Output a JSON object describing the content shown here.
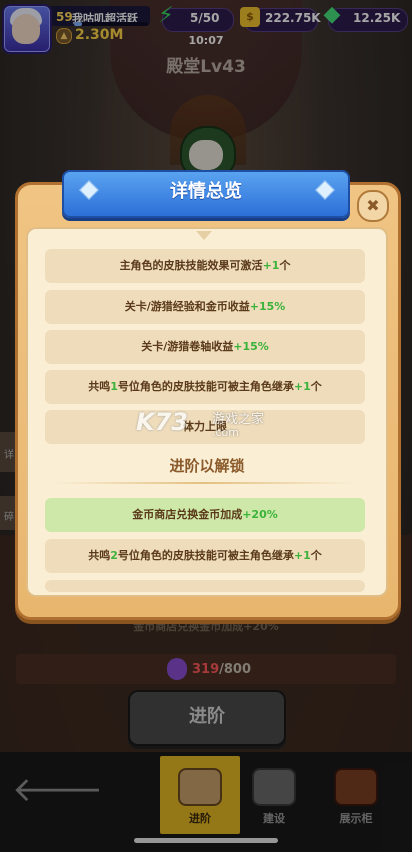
{
  "hud": {
    "level": "59",
    "player_name": "我咕叽超活跃",
    "power": "2.30M",
    "energy": "5/50",
    "gold": "222.75K",
    "gems": "12.25K",
    "time": "10:07"
  },
  "background": {
    "hall_title": "殿堂Lv43",
    "side_tab_1": "详",
    "side_tab_2": "碎",
    "dim_row_text": "金币商店兑换金币加成+20%",
    "progress_current": "319",
    "progress_slash": "/",
    "progress_total": "800",
    "advance_button": "进阶"
  },
  "modal": {
    "title": "详情总览",
    "close_symbol": "✖",
    "section_title": "进阶以解锁",
    "rows": [
      {
        "text": "主角色的皮肤技能效果可激活",
        "bonus": "+1",
        "suffix": "个"
      },
      {
        "text": "关卡/游猎经验和金币收益",
        "bonus": "+15%",
        "suffix": ""
      },
      {
        "text": "关卡/游猎卷轴收益",
        "bonus": "+15%",
        "suffix": ""
      },
      {
        "text_a": "共鸣",
        "num": "1",
        "text_b": "号位角色的皮肤技能可被主角色继承",
        "bonus": "+1",
        "suffix": "个"
      },
      {
        "text": "体力上限",
        "bonus": "",
        "suffix": ""
      },
      {
        "text": "金币商店兑换金币加成",
        "bonus": "+20%",
        "suffix": ""
      },
      {
        "text_a": "共鸣",
        "num": "2",
        "text_b": "号位角色的皮肤技能可被主角色继承",
        "bonus": "+1",
        "suffix": "个"
      }
    ]
  },
  "watermark": {
    "mark": "K73",
    "text": "游戏之家",
    "url": ".com"
  },
  "nav": {
    "back_icon": "🡐",
    "tabs": [
      {
        "label": "进阶",
        "active": true
      },
      {
        "label": "建设",
        "active": false
      },
      {
        "label": "展示柜",
        "active": false
      }
    ]
  },
  "colors": {
    "highlight_green": "#3bb33b",
    "active_tab": "#e4b722",
    "title_ribbon": "#2c6fd8"
  }
}
